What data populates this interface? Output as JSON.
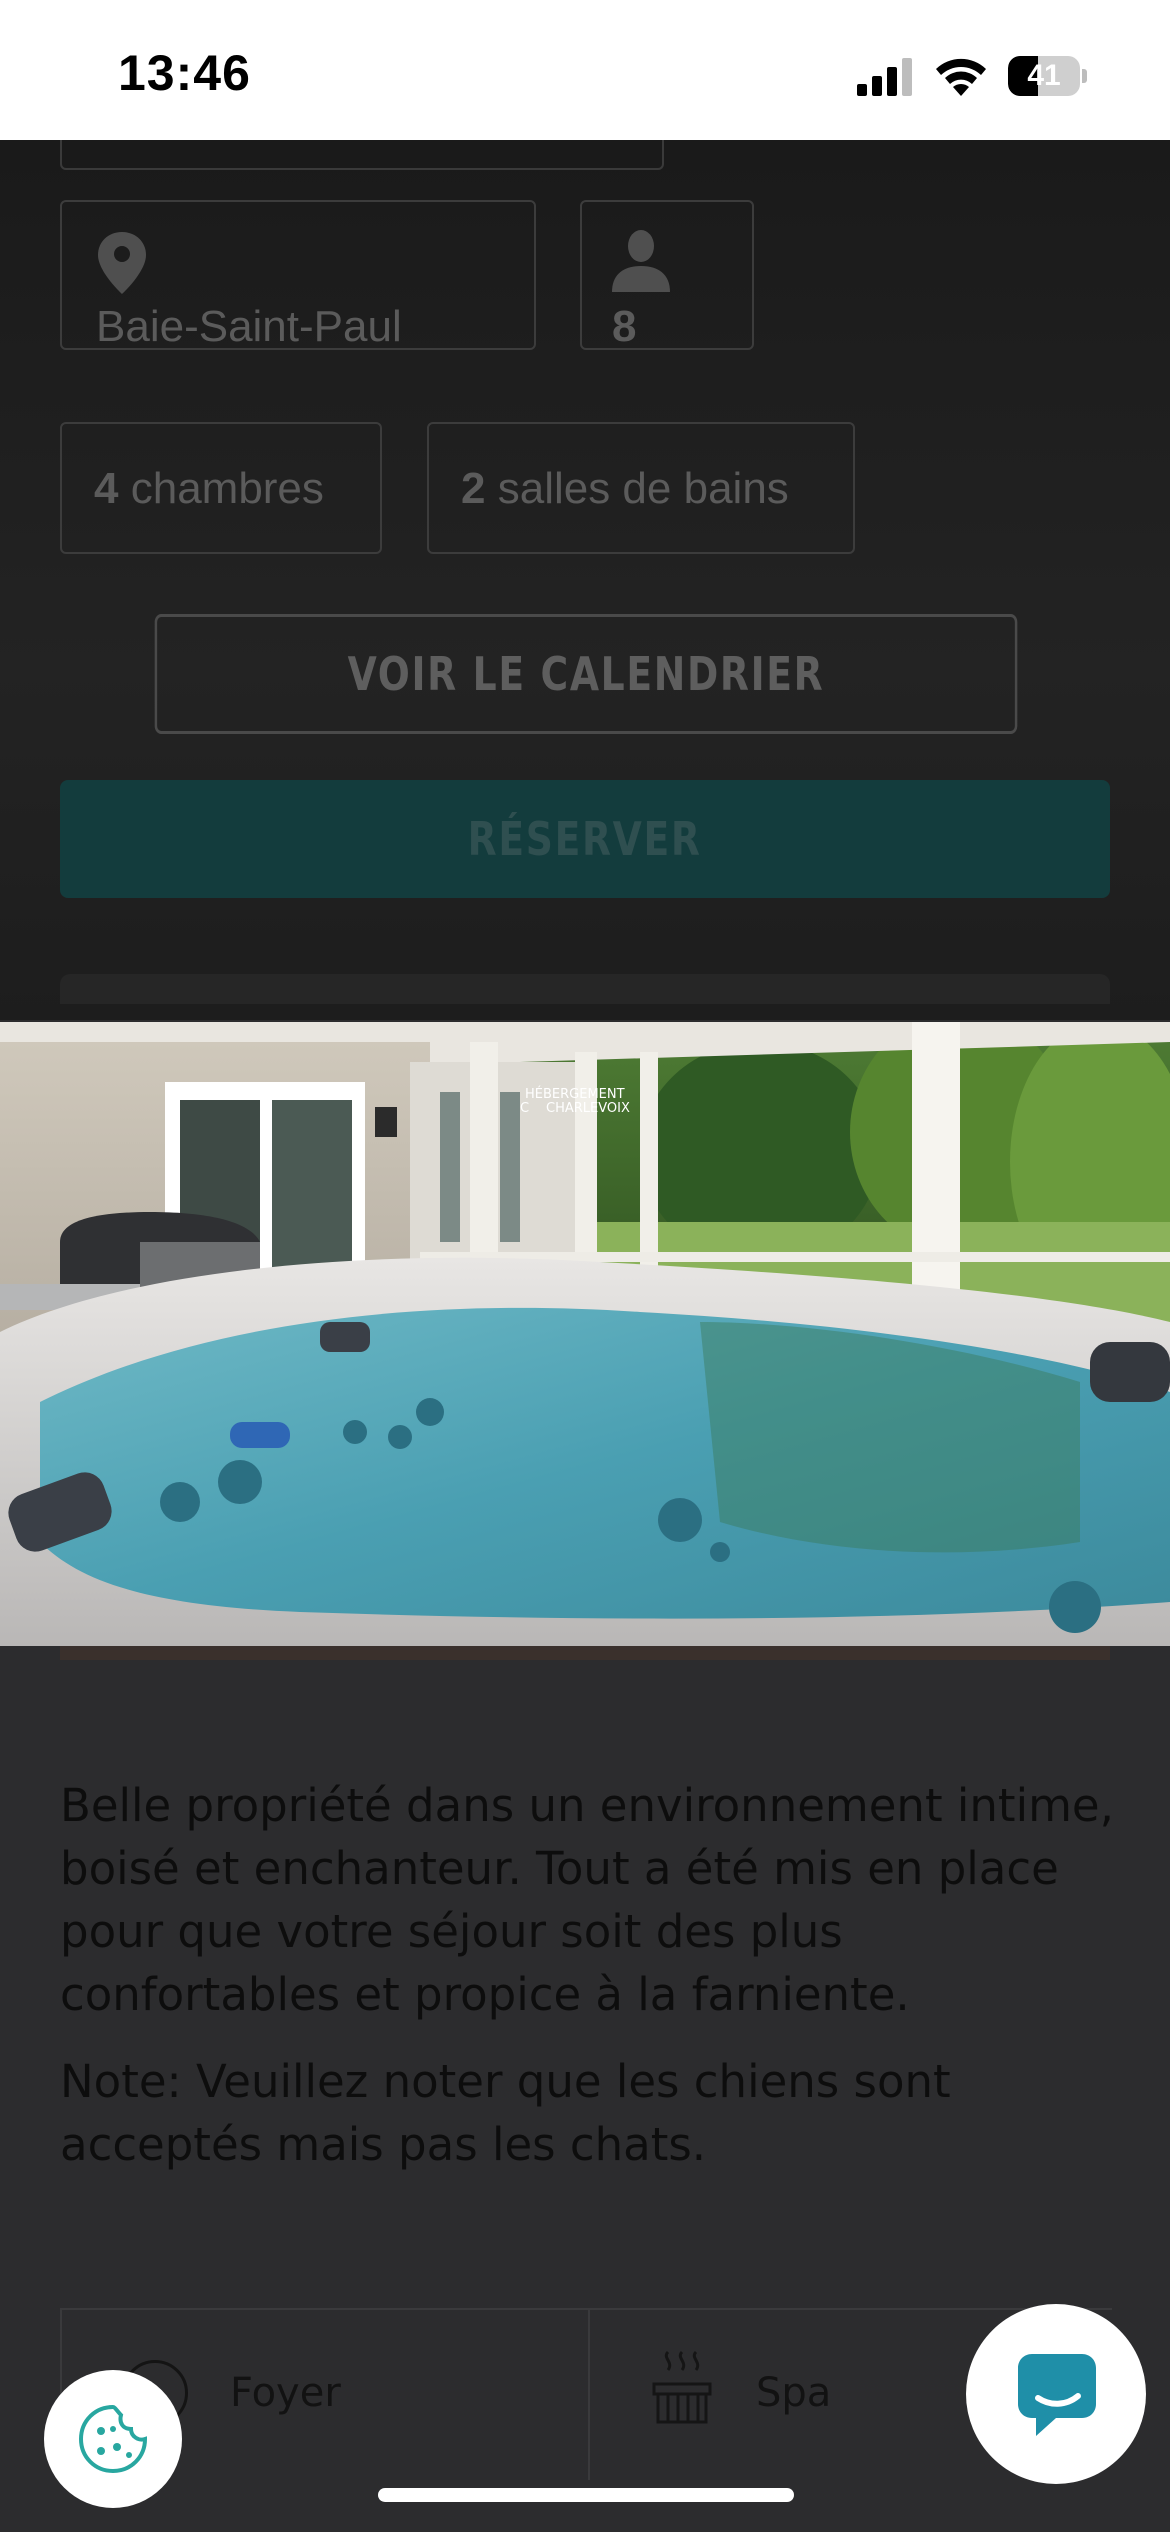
{
  "status_bar": {
    "time": "13:46",
    "battery_level": 41,
    "battery_text": "41",
    "signal_bars": 3,
    "wifi_strength": 3
  },
  "property": {
    "location": "Baie-Saint-Paul",
    "guests": "8",
    "bedrooms_count": "4",
    "bedrooms_label": "chambres",
    "bathrooms_count": "2",
    "bathrooms_label": "salles de bains"
  },
  "actions": {
    "calendar_label": "VOIR LE CALENDRIER",
    "reserve_label": "RÉSERVER"
  },
  "lightbox": {
    "watermark_line1": "HÉBERGEMENT",
    "watermark_line2": "CHARLEVOIX",
    "watermark_initial": "C"
  },
  "description": {
    "paragraph1": "Belle propriété dans un environnement intime, boisé et enchanteur. Tout a été mis en place pour que votre séjour soit des plus confortables et propice à la farniente.",
    "paragraph2": "Note: Veuillez noter que les chiens sont acceptés mais pas les chats."
  },
  "amenities": [
    {
      "label": "Foyer",
      "icon": "fireplace-icon"
    },
    {
      "label": "Spa",
      "icon": "hot-tub-icon"
    }
  ],
  "colors": {
    "overlay": "#2c2c2e",
    "reserve_button": "#133c3d",
    "chat_accent": "#1f8fa8",
    "cookie_accent": "#28a7a0",
    "water": "#5fb2c4"
  },
  "floating": {
    "cookie_icon": "cookie-icon",
    "chat_icon": "chat-bubble-icon"
  }
}
